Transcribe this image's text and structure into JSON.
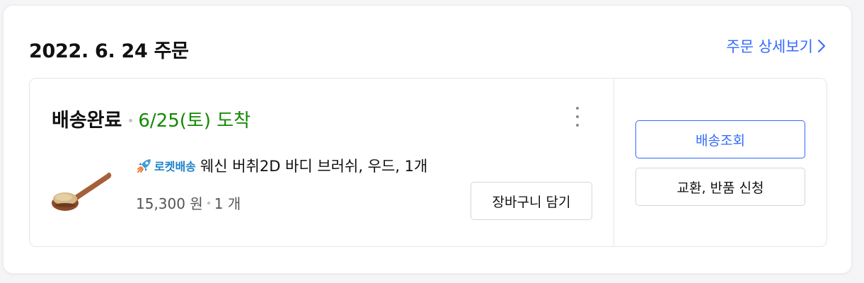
{
  "order": {
    "date_title": "2022. 6. 24 주문",
    "detail_link_label": "주문 상세보기",
    "detail_link_icon": "chevron-right-icon",
    "accent_color": "#346aff"
  },
  "shipment": {
    "status": "배송완료",
    "arrival": "6/25(토) 도착",
    "arrival_color": "#128900",
    "menu_icon": "more-vertical-icon"
  },
  "product": {
    "badge_icon": "rocket-icon",
    "badge_label": "로켓배송",
    "name": "웨신 버취2D 바디 브러쉬, 우드, 1개",
    "price": "15,300 원",
    "quantity": "1 개",
    "thumbnail_icon": "body-brush-image"
  },
  "actions": {
    "add_to_cart": "장바구니 담기",
    "track_shipment": "배송조회",
    "exchange_return": "교환, 반품 신청"
  }
}
